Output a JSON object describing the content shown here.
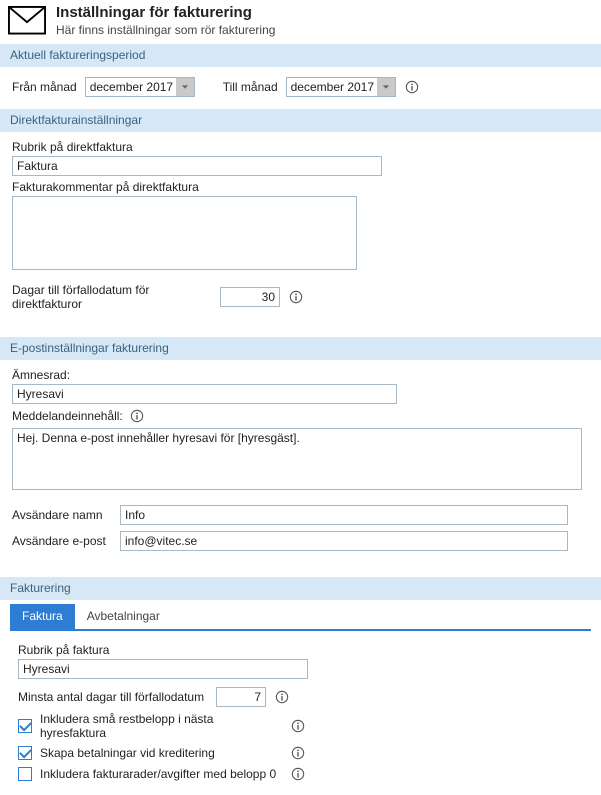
{
  "header": {
    "title": "Inställningar för fakturering",
    "subtitle": "Här finns inställningar som rör fakturering"
  },
  "section_period": {
    "heading": "Aktuell faktureringsperiod",
    "from_label": "Från månad",
    "from_value": "december 2017",
    "to_label": "Till månad",
    "to_value": "december 2017"
  },
  "section_direct": {
    "heading": "Direktfakturainställningar",
    "rubrik_label": "Rubrik på direktfaktura",
    "rubrik_value": "Faktura",
    "comment_label": "Fakturakommentar på direktfaktura",
    "comment_value": "",
    "days_label": "Dagar till förfallodatum för direktfakturor",
    "days_value": "30"
  },
  "section_email": {
    "heading": "E-postinställningar fakturering",
    "subject_label": "Ämnesrad:",
    "subject_value": "Hyresavi",
    "body_label": "Meddelandeinnehåll:",
    "body_value": "Hej. Denna e-post innehåller hyresavi för [hyresgäst].",
    "sender_name_label": "Avsändare namn",
    "sender_name_value": "Info",
    "sender_email_label": "Avsändare e-post",
    "sender_email_value": "info@vitec.se"
  },
  "section_invoice": {
    "heading": "Fakturering",
    "tabs": {
      "faktura": "Faktura",
      "avbetalningar": "Avbetalningar"
    },
    "rubrik_label": "Rubrik på faktura",
    "rubrik_value": "Hyresavi",
    "min_days_label": "Minsta antal dagar till förfallodatum",
    "min_days_value": "7",
    "chk1_label": "Inkludera små restbelopp i nästa hyresfaktura",
    "chk1_checked": true,
    "chk2_label": "Skapa betalningar vid kreditering",
    "chk2_checked": true,
    "chk3_label": "Inkludera fakturarader/avgifter med belopp 0",
    "chk3_checked": false
  }
}
